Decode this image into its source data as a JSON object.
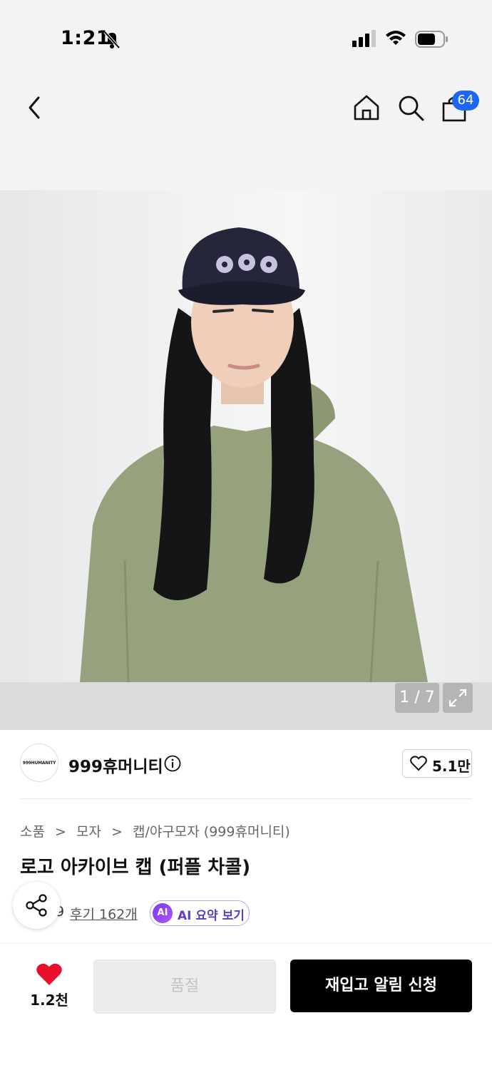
{
  "status_bar": {
    "time": "1:21"
  },
  "nav": {
    "cart_badge": "64"
  },
  "gallery": {
    "counter": "1 / 7"
  },
  "brand": {
    "logo_text": "999HUMANITY",
    "name": "999휴머니티",
    "likes": "5.1만"
  },
  "breadcrumb": {
    "items": [
      "소품",
      "모자",
      "캡/야구모자 (999휴머니티)"
    ],
    "separator": ">"
  },
  "product": {
    "title": "로고 아카이브 캡 (퍼플 차콜)",
    "rating_fragment": "9",
    "review_label": "후기 162개",
    "ai_badge": "AI",
    "ai_label": "AI 요약 보기"
  },
  "bottom_bar": {
    "wish_count": "1.2천",
    "soldout_label": "품절",
    "restock_label": "재입고 알림 신청"
  },
  "colors": {
    "accent": "#1e66f5",
    "heart": "#e8112d",
    "ai_purple": "#7c3aed",
    "primary_button": "#000000"
  }
}
